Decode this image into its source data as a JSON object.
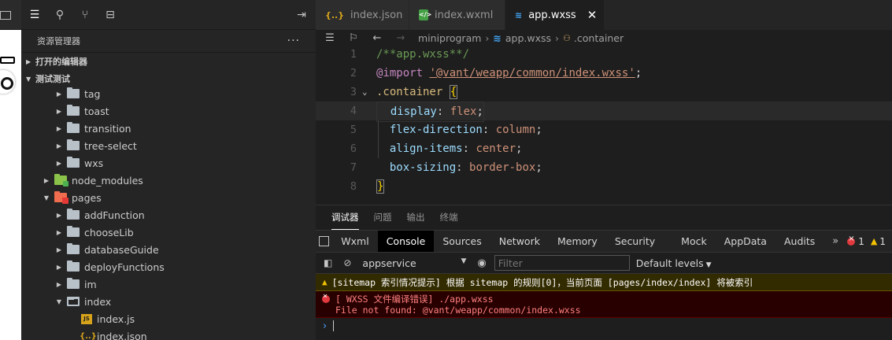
{
  "explorer": {
    "title": "资源管理器",
    "more": "···",
    "sections": {
      "open_editors": "打开的编辑器",
      "project": "测试测试"
    },
    "tree": [
      {
        "label": "tag",
        "kind": "folder",
        "depth": 2
      },
      {
        "label": "toast",
        "kind": "folder",
        "depth": 2
      },
      {
        "label": "transition",
        "kind": "folder",
        "depth": 2
      },
      {
        "label": "tree-select",
        "kind": "folder",
        "depth": 2
      },
      {
        "label": "wxs",
        "kind": "folder",
        "depth": 2
      },
      {
        "label": "node_modules",
        "kind": "node",
        "depth": 1
      },
      {
        "label": "pages",
        "kind": "pages",
        "depth": 1
      },
      {
        "label": "addFunction",
        "kind": "folder",
        "depth": 2
      },
      {
        "label": "chooseLib",
        "kind": "folder",
        "depth": 2
      },
      {
        "label": "databaseGuide",
        "kind": "folder",
        "depth": 2
      },
      {
        "label": "deployFunctions",
        "kind": "folder",
        "depth": 2
      },
      {
        "label": "im",
        "kind": "folder",
        "depth": 2
      },
      {
        "label": "index",
        "kind": "open",
        "depth": 2
      },
      {
        "label": "index.js",
        "kind": "js",
        "depth": 3
      },
      {
        "label": "index.json",
        "kind": "json",
        "depth": 3
      }
    ]
  },
  "editor": {
    "tabs": [
      {
        "label": "index.json",
        "icon": "json-file-icon",
        "glyph": "{..}"
      },
      {
        "label": "index.wxml",
        "icon": "wxml-file-icon",
        "glyph": "</>"
      },
      {
        "label": "app.wxss",
        "icon": "css-file-icon",
        "glyph": "≋"
      }
    ],
    "breadcrumb": {
      "folder": "miniprogram",
      "file": "app.wxss",
      "selector": ".container"
    },
    "lines": [
      {
        "no": "1",
        "html": "<span class='c-comment'>/**app.wxss**/</span>"
      },
      {
        "no": "2",
        "html": "<span class='c-at'>@import</span> <span class='c-str'>'@vant/weapp/common/index.wxss'</span><span class='c-punc'>;</span>"
      },
      {
        "no": "3",
        "html": "<span class='c-sel'>.container</span> <span class='c-brace'>{</span>"
      },
      {
        "no": "4",
        "html": "  <span class='c-prop'>display</span><span class='c-punc'>: </span><span class='c-val'>flex</span><span class='c-punc'>;</span>"
      },
      {
        "no": "5",
        "html": "  <span class='c-prop'>flex-direction</span><span class='c-punc'>: </span><span class='c-val'>column</span><span class='c-punc'>;</span>"
      },
      {
        "no": "6",
        "html": "  <span class='c-prop'>align-items</span><span class='c-punc'>: </span><span class='c-val'>center</span><span class='c-punc'>;</span>"
      },
      {
        "no": "7",
        "html": "  <span class='c-prop'>box-sizing</span><span class='c-punc'>: </span><span class='c-val'>border-box</span><span class='c-punc'>;</span>"
      },
      {
        "no": "8",
        "html": "<span class='c-brace'>}</span>"
      }
    ]
  },
  "panel": {
    "tabs": [
      "调试器",
      "问题",
      "输出",
      "终端"
    ],
    "devtools_tabs": [
      "Wxml",
      "Console",
      "Sources",
      "Network",
      "Memory",
      "Security",
      "Mock",
      "AppData",
      "Audits"
    ],
    "devtools_more": "»",
    "error_count": "1",
    "warning_count": "1",
    "context": "appservice",
    "filter_placeholder": "Filter",
    "levels": "Default levels",
    "warning_message": "[sitemap 索引情况提示] 根据 sitemap 的规则[0]，当前页面 [pages/index/index] 将被索引",
    "error_line1": "[ WXSS 文件编译错误] ./app.wxss",
    "error_line2": "File not found: @vant/weapp/common/index.wxss",
    "prompt": "›"
  }
}
